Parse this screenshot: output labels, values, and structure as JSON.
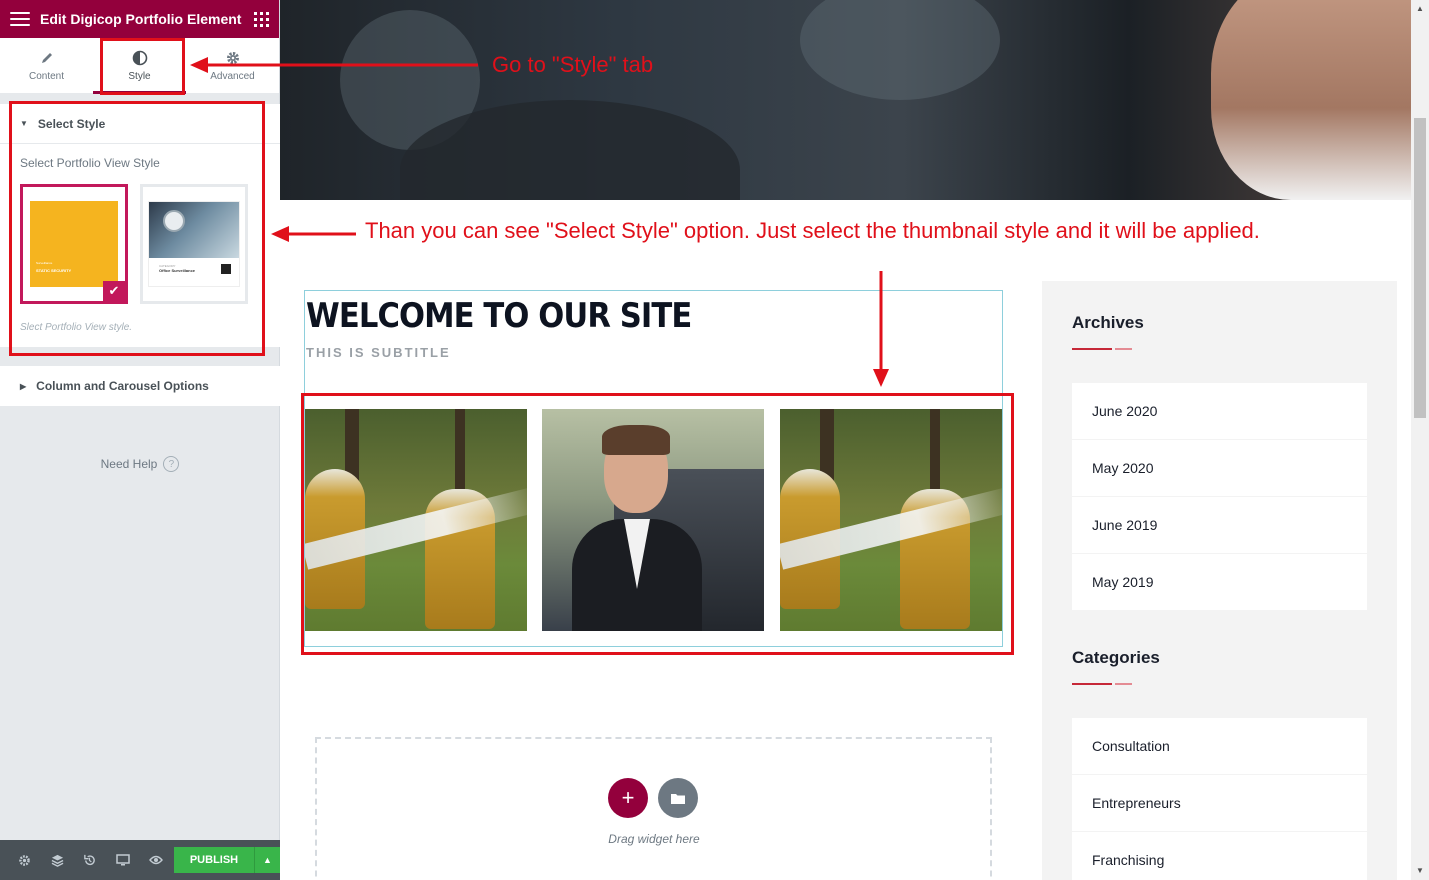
{
  "panel": {
    "header_title": "Edit Digicop Portfolio Element",
    "tabs": [
      {
        "label": "Content",
        "icon": "pencil-icon"
      },
      {
        "label": "Style",
        "icon": "half-circle-icon"
      },
      {
        "label": "Advanced",
        "icon": "gear-icon"
      }
    ],
    "select_style": {
      "heading": "Select Style",
      "label": "Select Portfolio View Style",
      "note": "Slect Portfolio View style.",
      "thumb1_caption_small": "Surveillance",
      "thumb1_caption": "STATIC SECURITY",
      "thumb2_caption_small": "CATEGORY",
      "thumb2_caption": "Office Surveillance"
    },
    "column_options_heading": "Column and Carousel Options",
    "need_help": "Need Help",
    "footer": {
      "publish_label": "PUBLISH",
      "publish_caret": "▲"
    }
  },
  "preview": {
    "title": "WELCOME TO OUR SITE",
    "subtitle": "THIS IS SUBTITLE",
    "drop_zone_text": "Drag widget here",
    "archives": {
      "heading": "Archives",
      "items": [
        "June 2020",
        "May 2020",
        "June 2019",
        "May 2019"
      ]
    },
    "categories": {
      "heading": "Categories",
      "items": [
        "Consultation",
        "Entrepreneurs",
        "Franchising"
      ]
    }
  },
  "annotations": {
    "tab_hint": "Go to \"Style\" tab",
    "style_hint": "Than you can see \"Select Style\" option. Just select the thumbnail style and it will be applied."
  },
  "colors": {
    "brand": "#93003c",
    "selection": "#c2185b",
    "publish": "#39b54a",
    "annotation": "#e0101a",
    "widget_accent": "#c62838"
  }
}
